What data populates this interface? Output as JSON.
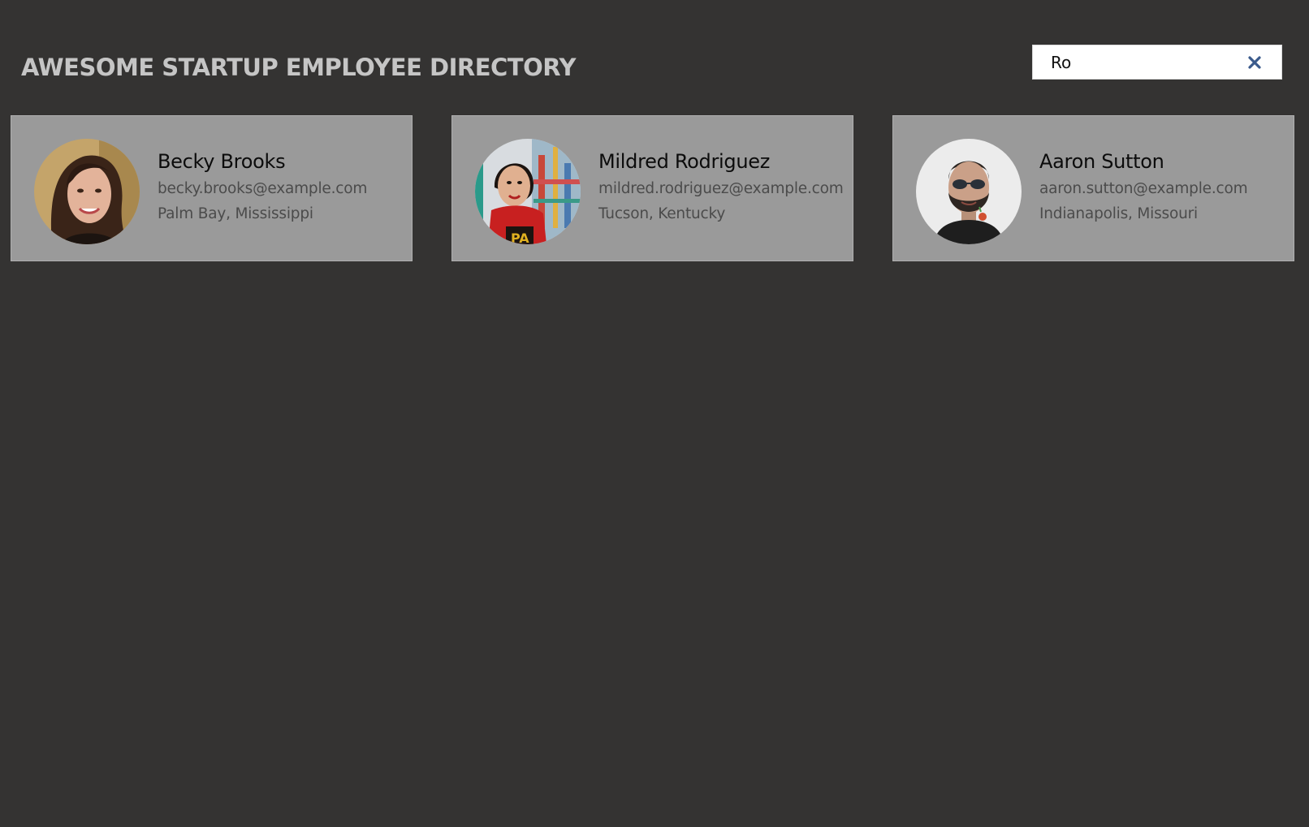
{
  "header": {
    "title": "AWESOME STARTUP EMPLOYEE DIRECTORY"
  },
  "search": {
    "value": "Ro",
    "clear_icon": "close-icon",
    "clear_icon_color": "#3a5a8c"
  },
  "employees": [
    {
      "name": "Becky Brooks",
      "email": "becky.brooks@example.com",
      "location": "Palm Bay, Mississippi",
      "avatar": "woman-portrait"
    },
    {
      "name": "Mildred Rodriguez",
      "email": "mildred.rodriguez@example.com",
      "location": "Tucson, Kentucky",
      "avatar": "woman-portrait"
    },
    {
      "name": "Aaron Sutton",
      "email": "aaron.sutton@example.com",
      "location": "Indianapolis, Missouri",
      "avatar": "man-portrait"
    }
  ],
  "colors": {
    "background": "#343332",
    "card": "#9a9a9a",
    "title": "#c5c5c5"
  }
}
